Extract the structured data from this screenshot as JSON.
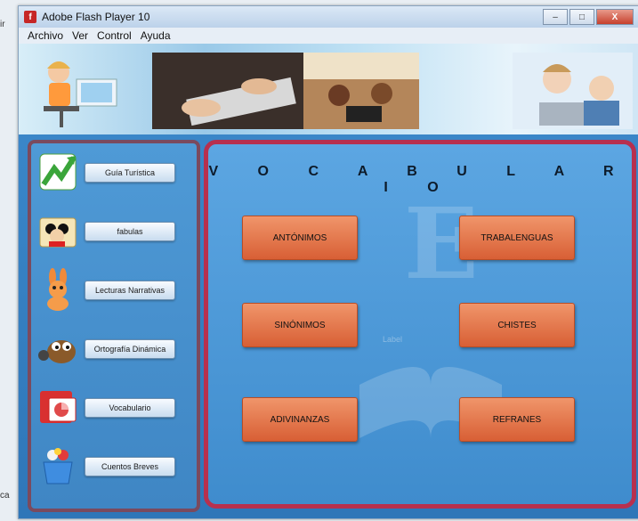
{
  "edge_text": {
    "top_left": "ir",
    "bottom_left": "ca"
  },
  "window": {
    "title": "Adobe Flash Player 10",
    "app_icon_glyph": "f",
    "controls": {
      "minimize": "–",
      "maximize": "□",
      "close": "X"
    }
  },
  "menu": [
    "Archivo",
    "Ver",
    "Control",
    "Ayuda"
  ],
  "sidebar": {
    "items": [
      {
        "label": "Guía Turística",
        "icon": "chart-arrow-icon"
      },
      {
        "label": "fabulas",
        "icon": "mickey-folder-icon"
      },
      {
        "label": "Lecturas Narrativas",
        "icon": "rabbit-icon"
      },
      {
        "label": "Ortografía Dinámica",
        "icon": "gimp-icon"
      },
      {
        "label": "Vocabulario",
        "icon": "presentation-icon"
      },
      {
        "label": "Cuentos Breves",
        "icon": "toy-bucket-icon"
      }
    ]
  },
  "main": {
    "title": "V O C A B U L A R I O",
    "ghost_label": "Label",
    "buttons": [
      "ANTÓNIMOS",
      "TRABALENGUAS",
      "SINÓNIMOS",
      "CHISTES",
      "ADIVINANZAS",
      "REFRANES"
    ]
  },
  "colors": {
    "panel_blue": "#3f86c4",
    "left_border": "#7a4a5e",
    "main_border": "#b7304e",
    "button_orange": "#e0714a"
  }
}
